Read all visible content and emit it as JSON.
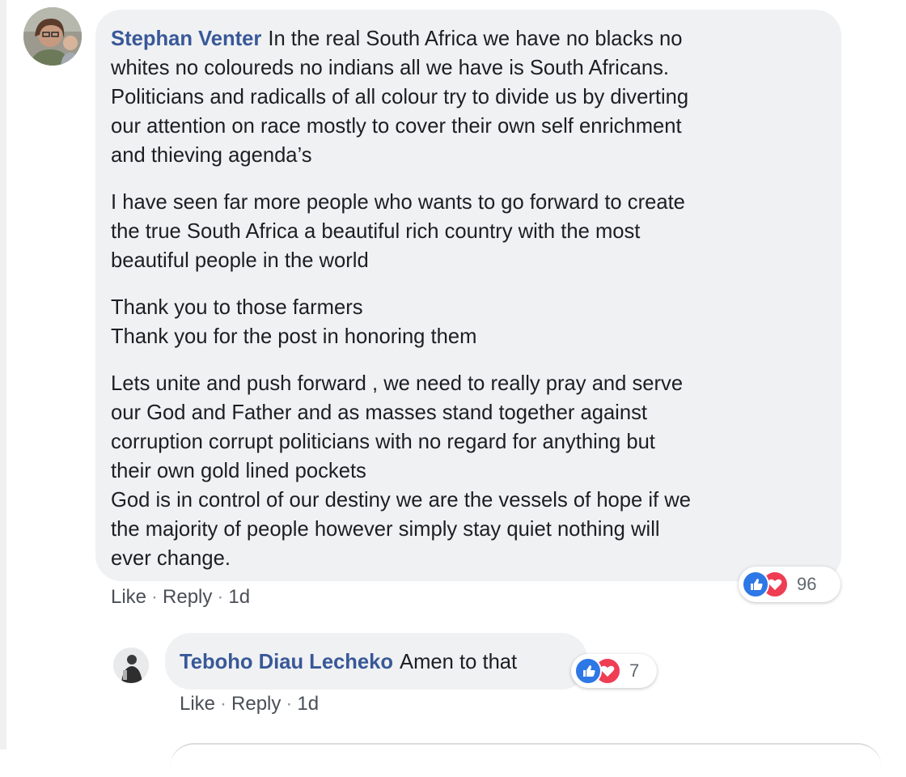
{
  "main_comment": {
    "author": "Stephan Venter",
    "paragraphs": [
      [
        "In the real South Africa we have no blacks no",
        "whites no coloureds no indians all we have is South Africans.",
        "Politicians and radicalls of all colour try to divide us by diverting",
        "our attention on race mostly to cover their own self enrichment",
        "and thieving agenda’s"
      ],
      [
        "I have seen far more people who wants to go forward to create",
        "the true South Africa a beautiful rich country with the most",
        "beautiful people in the world"
      ],
      [
        "Thank you to those farmers",
        "Thank you for the post in honoring them"
      ],
      [
        "Lets unite and push forward , we need to really pray and serve",
        "our God and Father and as masses stand together against",
        "corruption corrupt politicians with no regard for anything but",
        "their own gold lined pockets",
        "God is in control of our destiny we are the vessels of hope if we",
        "the majority of people however simply stay quiet nothing will",
        "ever change."
      ]
    ],
    "actions": {
      "like": "Like",
      "reply": "Reply",
      "time": "1d",
      "separator": "·"
    },
    "reactions": {
      "count": "96",
      "types": [
        "like-icon",
        "love-icon"
      ]
    }
  },
  "reply_comment": {
    "author": "Teboho Diau Lecheko",
    "text": "Amen to that",
    "actions": {
      "like": "Like",
      "reply": "Reply",
      "time": "1d",
      "separator": "·"
    },
    "reactions": {
      "count": "7",
      "types": [
        "like-icon",
        "love-icon"
      ]
    }
  },
  "colors": {
    "author": "#385898",
    "bubble": "#f0f1f3",
    "like": "#2d77e6",
    "love": "#ef3d54",
    "meta": "#606770"
  }
}
